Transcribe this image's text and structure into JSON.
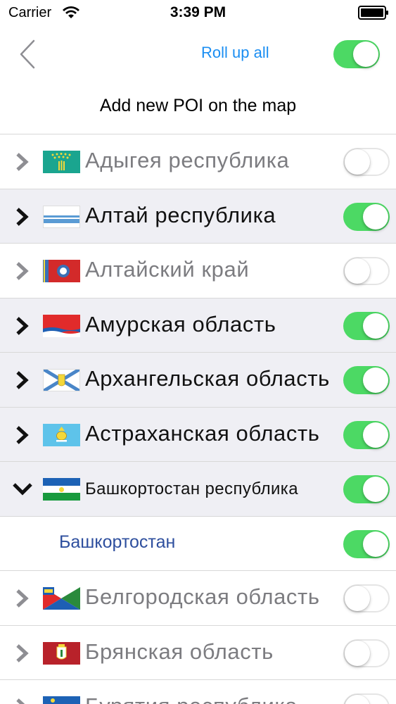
{
  "status": {
    "carrier": "Carrier",
    "time": "3:39 PM"
  },
  "nav": {
    "roll_up": "Roll up all",
    "roll_up_switch_on": true
  },
  "title": "Add new POI on the map",
  "regions": [
    {
      "label": "Адыгея республика",
      "enabled": false,
      "expanded": false,
      "flag": "adygea"
    },
    {
      "label": "Алтай республика",
      "enabled": true,
      "expanded": false,
      "flag": "altai-republic"
    },
    {
      "label": "Алтайский край",
      "enabled": false,
      "expanded": false,
      "flag": "altai-krai"
    },
    {
      "label": "Амурская область",
      "enabled": true,
      "expanded": false,
      "flag": "amur"
    },
    {
      "label": "Архангельская область",
      "enabled": true,
      "expanded": false,
      "flag": "arkhangelsk"
    },
    {
      "label": "Астраханская область",
      "enabled": true,
      "expanded": false,
      "flag": "astrakhan"
    },
    {
      "label": "Башкортостан республика",
      "enabled": true,
      "expanded": true,
      "flag": "bashkortostan"
    },
    {
      "label": "Башкортостан",
      "enabled": true,
      "sub": true
    },
    {
      "label": "Белгородская область",
      "enabled": false,
      "expanded": false,
      "flag": "belgorod"
    },
    {
      "label": "Брянская область",
      "enabled": false,
      "expanded": false,
      "flag": "bryansk"
    },
    {
      "label": "Бурятия республика",
      "enabled": false,
      "expanded": false,
      "flag": "buryatia"
    }
  ],
  "colors": {
    "switch_on": "#4cd964",
    "link": "#1b8ef2",
    "sub_label": "#2e4f9e",
    "shaded_row": "#efeff4"
  }
}
